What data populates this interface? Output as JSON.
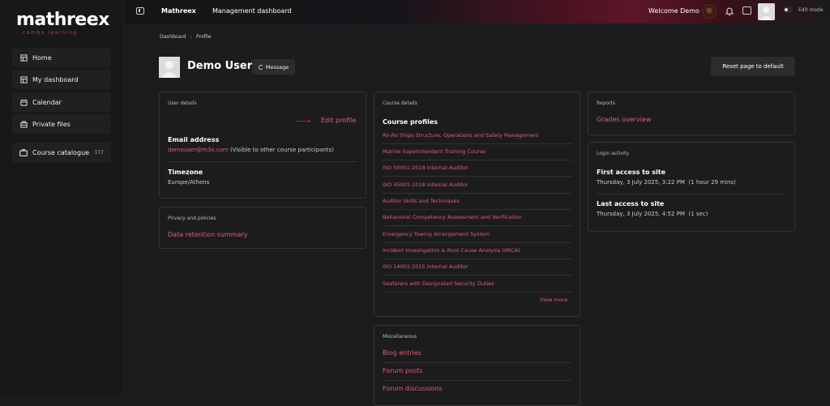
{
  "brand": {
    "name": "mathreex",
    "tagline": "combo learning"
  },
  "sidebar": {
    "items": [
      {
        "label": "Home",
        "icon": "home-icon"
      },
      {
        "label": "My dashboard",
        "icon": "dashboard-icon"
      },
      {
        "label": "Calendar",
        "icon": "calendar-icon"
      },
      {
        "label": "Private files",
        "icon": "files-icon"
      },
      {
        "label": "Course catalogue",
        "icon": "catalogue-icon",
        "count": "377"
      }
    ]
  },
  "topbar": {
    "site_name": "Mathreex",
    "nav_link": "Management dashboard",
    "welcome": "Welcome Demo",
    "edit_mode": "Edit mode"
  },
  "breadcrumb": {
    "items": [
      "Dashboard",
      "Profile"
    ]
  },
  "profile": {
    "name": "Demo User",
    "message_button": "Message",
    "reset_button": "Reset page to default"
  },
  "user_details": {
    "header": "User details",
    "edit_profile": "Edit profile",
    "email_label": "Email address",
    "email_value": "demouser@m3x.com",
    "email_note": "(Visible to other course participants)",
    "timezone_label": "Timezone",
    "timezone_value": "Europe/Athens"
  },
  "privacy": {
    "header": "Privacy and policies",
    "link": "Data retention summary"
  },
  "course_details": {
    "header": "Course details",
    "title": "Course profiles",
    "courses": [
      "Ro-Ro Ships Structure, Operations and Safety Management",
      "Marine Superintendent Training Course",
      "ISO 50001:2018 Internal Auditor",
      "ISO 45001:2018 Internal Auditor",
      "Auditor Skills and Techniques",
      "Behavioral Competency Assessment and Verification",
      "Emergency Towing Arrangement System",
      "Incident Investigation & Root Cause Analysis (IIRCA)",
      "ISO 14001:2015 Internal Auditor",
      "Seafarers with Designated Security Duties"
    ],
    "view_more": "View more"
  },
  "misc": {
    "header": "Miscellaneous",
    "links": [
      "Blog entries",
      "Forum posts",
      "Forum discussions"
    ]
  },
  "reports": {
    "header": "Reports",
    "link": "Grades overview"
  },
  "login_activity": {
    "header": "Login activity",
    "first_label": "First access to site",
    "first_value": "Thursday, 3 July 2025, 3:22 PM  (1 hour 29 mins)",
    "last_label": "Last access to site",
    "last_value": "Thursday, 3 July 2025, 4:52 PM  (1 sec)"
  },
  "colors": {
    "accent": "#e25c78",
    "brand_red": "#d23a5a",
    "background": "#1c1c1f"
  }
}
